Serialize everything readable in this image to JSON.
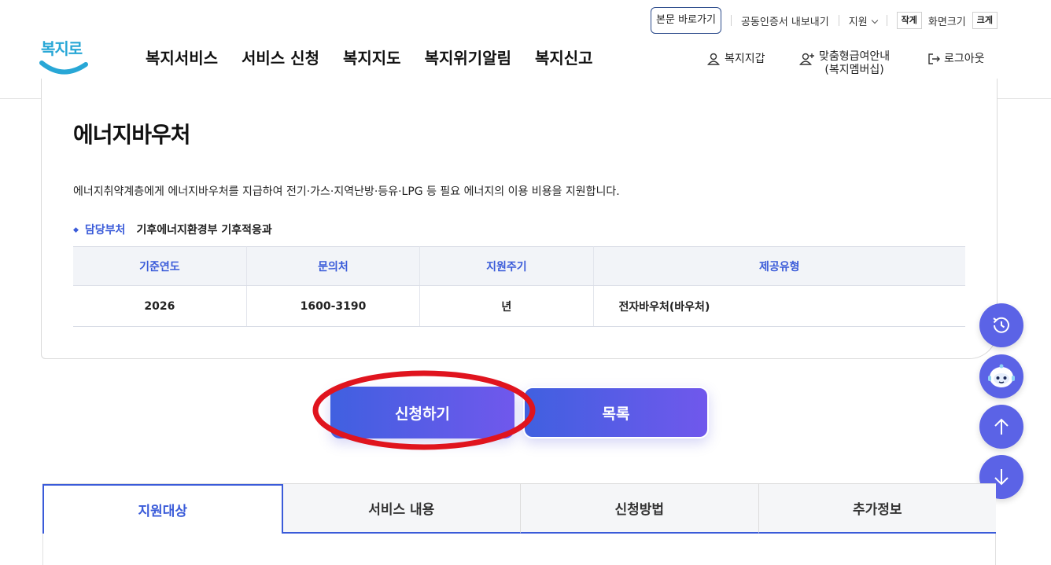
{
  "header": {
    "logo_text": "복지로",
    "util": {
      "skip_to_content": "본문 바로가기",
      "export_cert": "공동인증서 내보내기",
      "support": "지원",
      "font_small": "작게",
      "zoom_label": "화면크기",
      "font_large": "크게"
    },
    "gnb": [
      "복지서비스",
      "서비스 신청",
      "복지지도",
      "복지위기알림",
      "복지신고"
    ],
    "right_menu": {
      "wallet": "복지지갑",
      "membership_line1": "맞춤형급여안내",
      "membership_line2": "(복지멤버십)",
      "logout": "로그아웃"
    }
  },
  "service": {
    "title": "에너지바우처",
    "description": "에너지취약계층에게 에너지바우처를 지급하여 전기·가스·지역난방·등유·LPG 등 필요 에너지의 이용 비용을 지원합니다.",
    "dept_label": "담당부처",
    "dept_value": "기후에너지환경부 기후적응과",
    "table": {
      "headers": [
        "기준연도",
        "문의처",
        "지원주기",
        "제공유형"
      ],
      "row": [
        "2026",
        "1600-3190",
        "년",
        "전자바우처(바우처)"
      ]
    }
  },
  "actions": {
    "apply": "신청하기",
    "list": "목록"
  },
  "floating": [
    "recent-history-icon",
    "chatbot-icon",
    "arrow-up-icon",
    "arrow-down-icon"
  ],
  "tabs": [
    {
      "label": "지원대상",
      "active": true
    },
    {
      "label": "서비스 내용",
      "active": false
    },
    {
      "label": "신청방법",
      "active": false
    },
    {
      "label": "추가정보",
      "active": false
    }
  ],
  "colors": {
    "accent": "#3a5bd9",
    "button_start": "#4060e0",
    "button_end": "#7058ec",
    "highlight": "#e0141e",
    "fab": "#5b63e6"
  }
}
